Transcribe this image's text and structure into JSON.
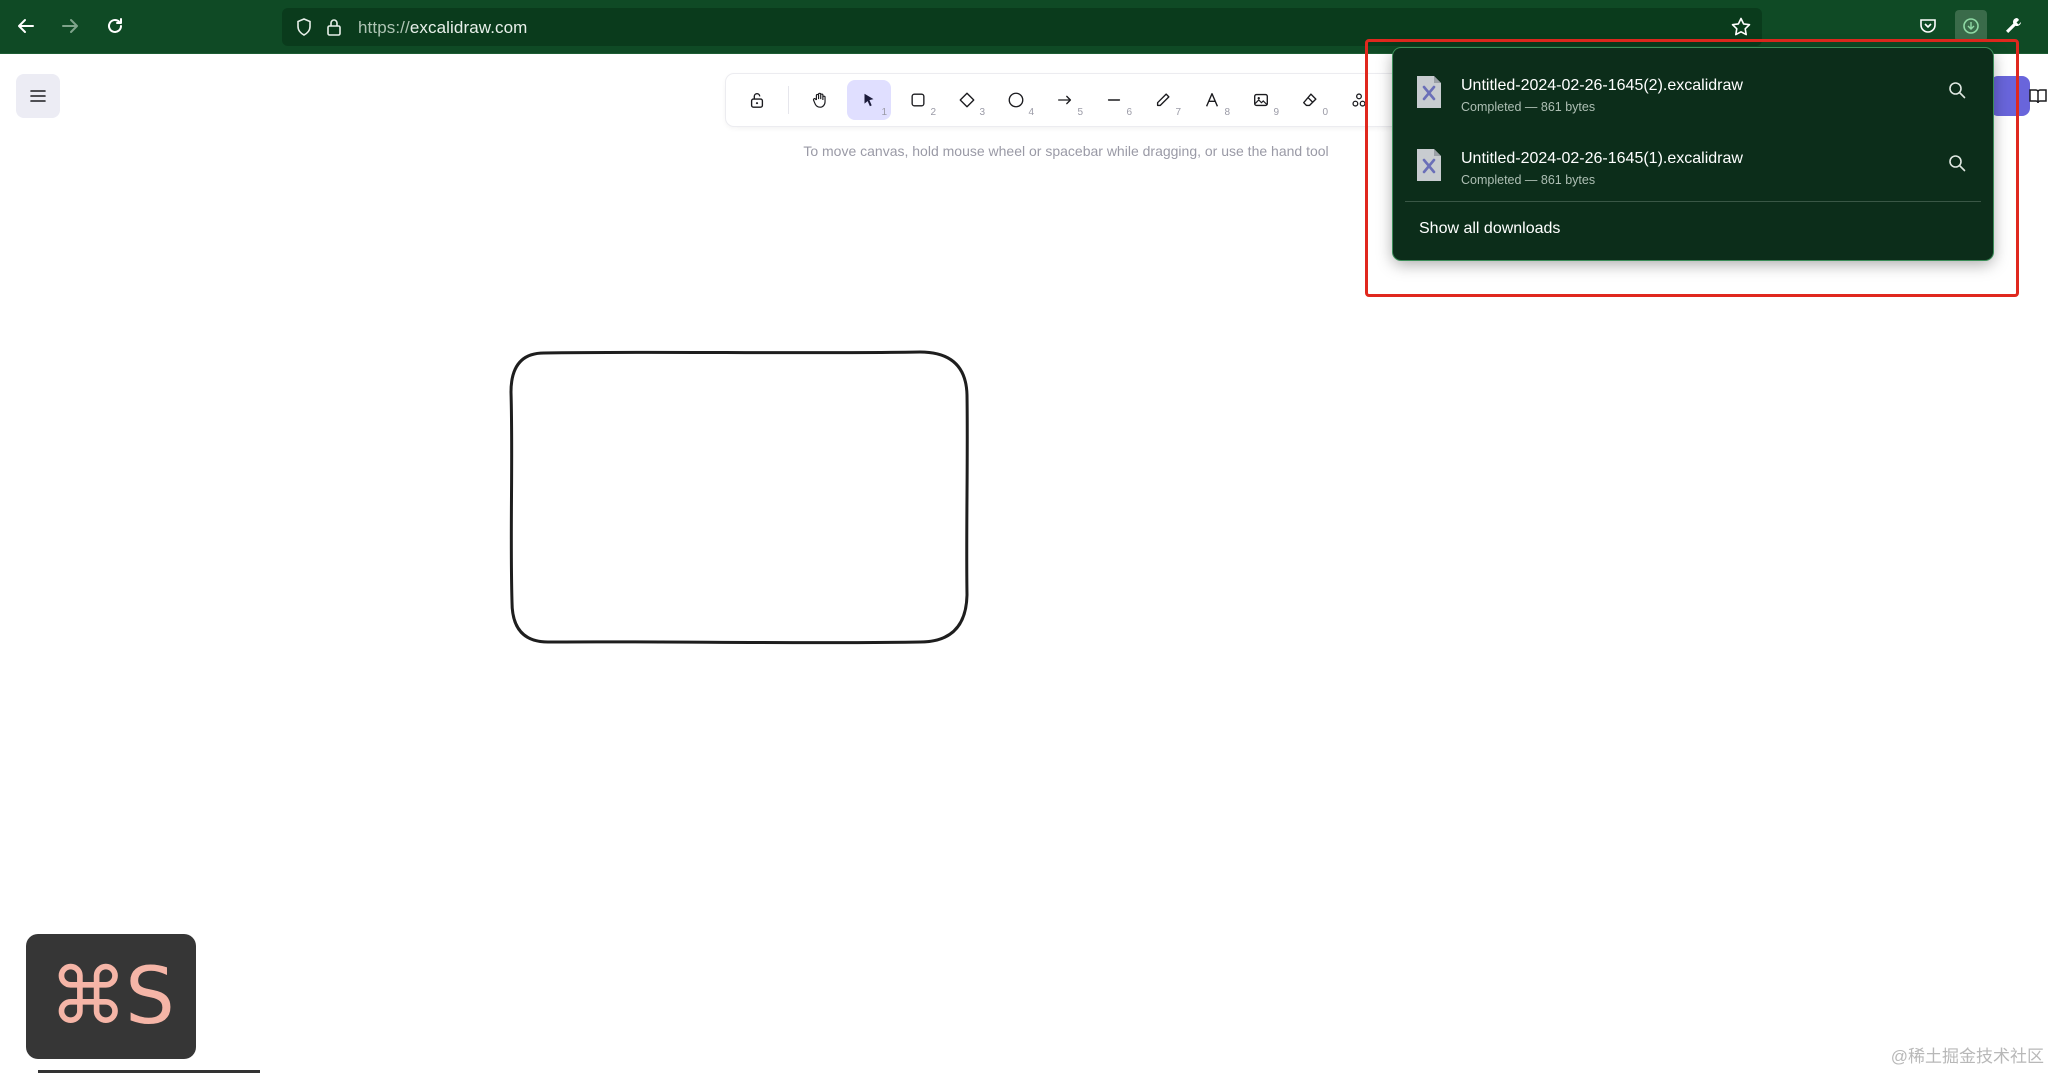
{
  "browser": {
    "url_scheme": "https://",
    "url_host": "excalidraw.com"
  },
  "toolbar": {
    "tools": [
      {
        "name": "lock",
        "key": ""
      },
      {
        "name": "hand",
        "key": ""
      },
      {
        "name": "selection",
        "key": "1"
      },
      {
        "name": "rectangle",
        "key": "2"
      },
      {
        "name": "diamond",
        "key": "3"
      },
      {
        "name": "ellipse",
        "key": "4"
      },
      {
        "name": "arrow",
        "key": "5"
      },
      {
        "name": "line",
        "key": "6"
      },
      {
        "name": "draw",
        "key": "7"
      },
      {
        "name": "text",
        "key": "8"
      },
      {
        "name": "image",
        "key": "9"
      },
      {
        "name": "eraser",
        "key": "0"
      },
      {
        "name": "extra-tools",
        "key": ""
      }
    ],
    "active_tool": "selection",
    "hint": "To move canvas, hold mouse wheel or spacebar while dragging, or use the hand tool"
  },
  "downloads": {
    "items": [
      {
        "filename": "Untitled-2024-02-26-1645(2).excalidraw",
        "status": "Completed — 861 bytes"
      },
      {
        "filename": "Untitled-2024-02-26-1645(1).excalidraw",
        "status": "Completed — 861 bytes"
      }
    ],
    "show_all_label": "Show all downloads"
  },
  "shortcut_overlay": {
    "keys": "⌘S"
  },
  "watermark": "@稀土掘金技术社区",
  "colors": {
    "browser_bar": "#0f4a25",
    "panel_bg": "#0c2d1a",
    "highlight": "#e0281e",
    "active_tool": "#e0dfff",
    "accent": "#6965db"
  }
}
